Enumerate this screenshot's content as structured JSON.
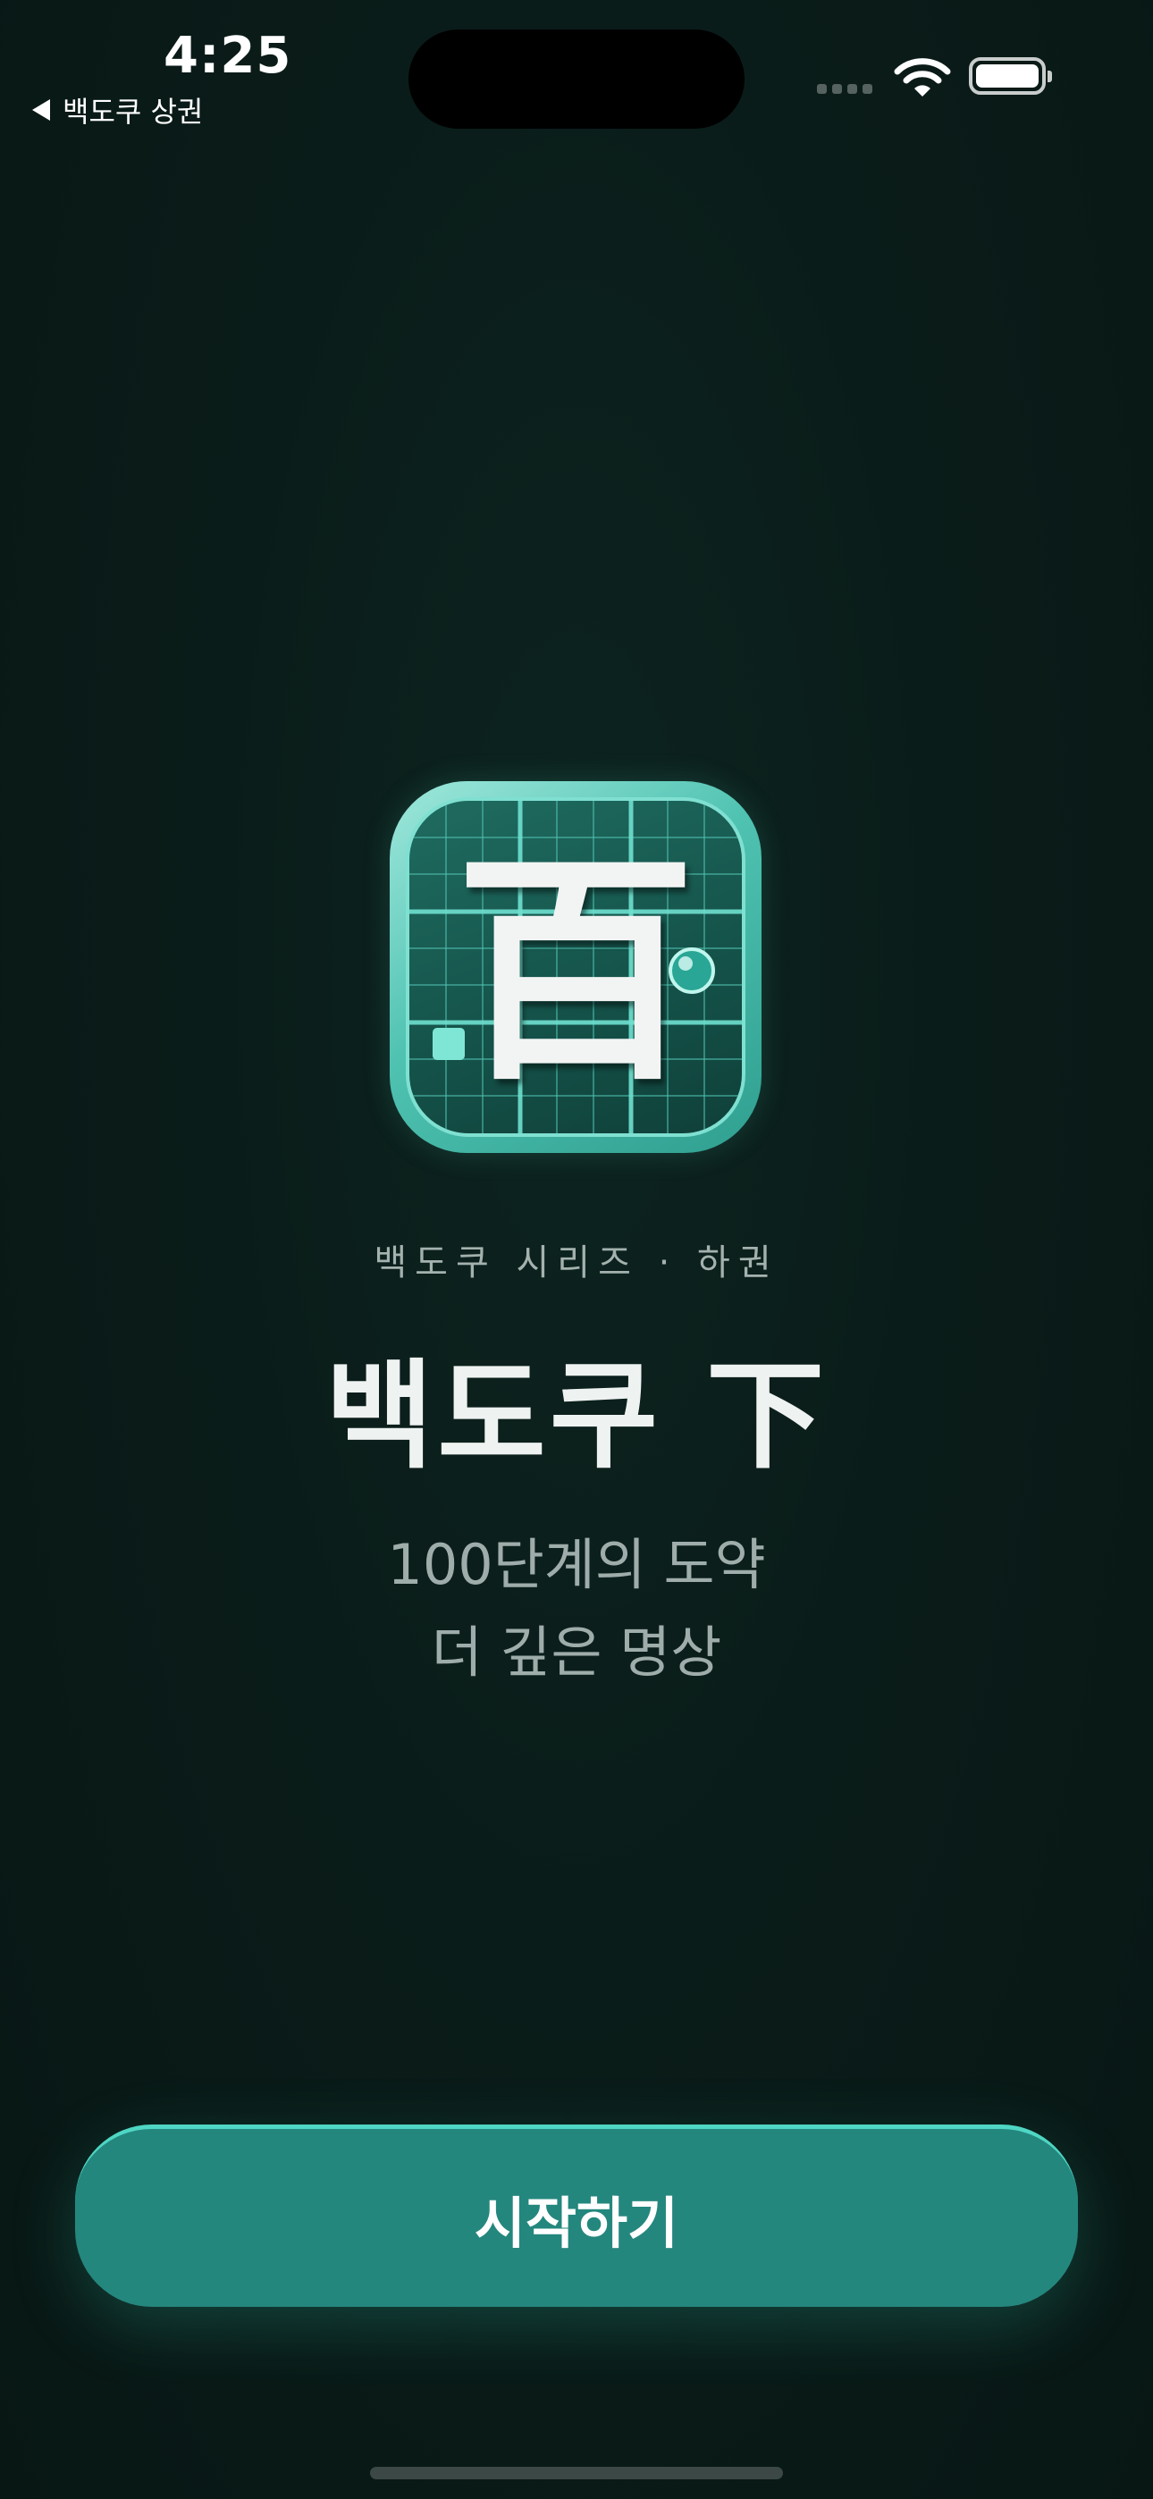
{
  "status_bar": {
    "time": "4:25",
    "back_label": "백도쿠 상권"
  },
  "app_icon": {
    "glyph": "百"
  },
  "content": {
    "series_label": "백도쿠 시리즈 · 하권",
    "title": "백도쿠 下",
    "tagline_line1": "100단계의 도약",
    "tagline_line2": "더 깊은 명상"
  },
  "actions": {
    "start_label": "시작하기"
  },
  "colors": {
    "background": "#091a17",
    "accent": "#24877e",
    "accent_highlight": "#4fd6c4"
  }
}
